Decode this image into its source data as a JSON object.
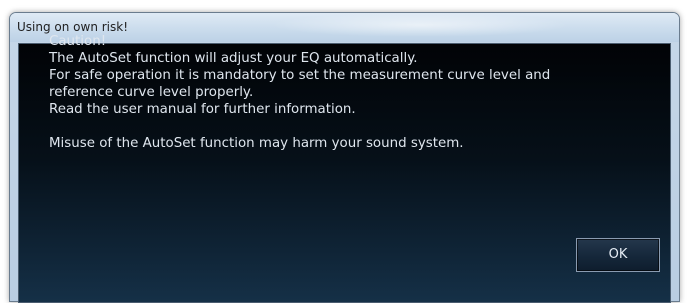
{
  "window": {
    "title": "Using on own risk!"
  },
  "message": {
    "lines": [
      "Caution!",
      "The AutoSet function will adjust your EQ automatically.",
      "For safe operation it is mandatory to set the measurement curve level and",
      "reference curve level properly.",
      "Read the user manual for further information."
    ],
    "warning": "Misuse of the AutoSet function may harm your sound system."
  },
  "buttons": {
    "ok_label": "OK"
  }
}
